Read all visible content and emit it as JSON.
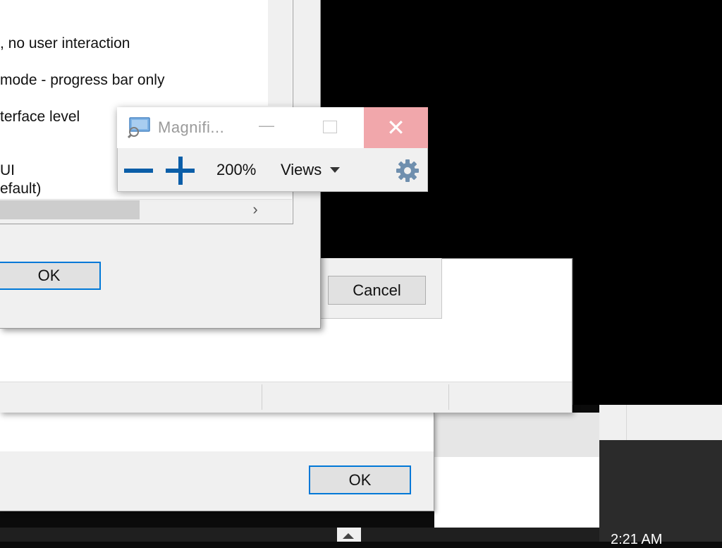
{
  "settings_dialog": {
    "options": [
      ", no user interaction",
      " mode - progress bar only",
      "terface level",
      " UI",
      "efault)"
    ],
    "ok_label": "OK"
  },
  "install_dialog": {
    "cancel_label": "Cancel"
  },
  "bottom_dialog": {
    "ok_label": "OK"
  },
  "magnifier": {
    "title": "Magnifi...",
    "zoom": "200%",
    "views_label": "Views",
    "icons": [
      "magnifier-icon",
      "minimize-icon",
      "maximize-icon",
      "close-icon",
      "zoom-out-icon",
      "zoom-in-icon",
      "chevron-down-icon",
      "gear-icon"
    ],
    "close_hover_color": "#f1a7ab",
    "accent_color": "#0b5ea8"
  },
  "taskbar": {
    "clock": "2:21 AM"
  }
}
